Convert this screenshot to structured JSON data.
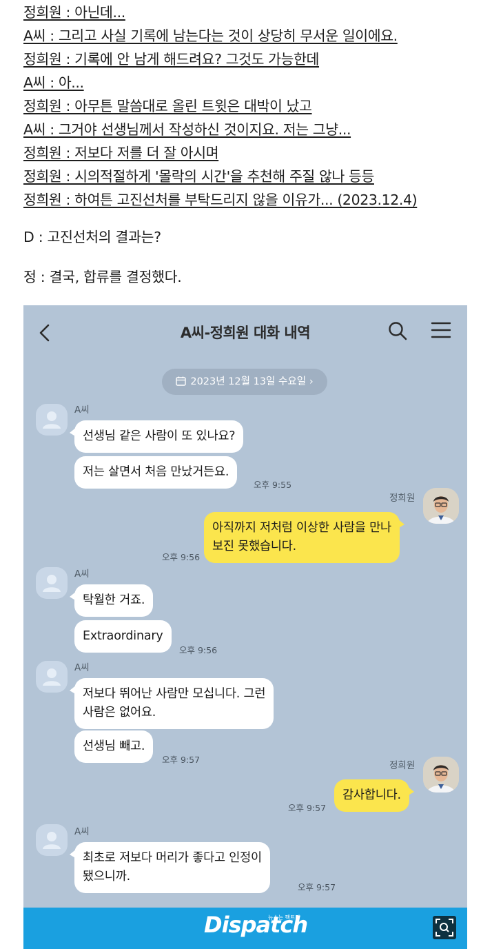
{
  "article": {
    "quotes": [
      "정희원 : 아닌데...",
      "A씨 : 그리고 사실 기록에 남는다는 것이 상당히 무서운 일이에요.",
      "정희원 : 기록에 안 남게 해드려요? 그것도 가능한데",
      "A씨 : 아...",
      "정희원 : 아무튼 말씀대로 올린 트윗은 대박이 났고",
      "A씨 : 그거야 선생님께서 작성하신 것이지요. 저는 그냥...",
      "정희원 : 저보다 저를 더 잘 아시며",
      "정희원 : 시의적절하게 '몰락의 시간'을 추천해 주질 않나 등등",
      "정희원 : 하여튼 고진선처를 부탁드리지 않을 이유가... (2023.12.4)"
    ],
    "question": "D : 고진선처의 결과는?",
    "answer": "정 : 결국, 합류를 결정했다."
  },
  "chat": {
    "title": "A씨-정희원 대화 내역",
    "date": "2023년 12월 13일 수요일",
    "other_name": "A씨",
    "my_name": "정희원",
    "messages": {
      "m1": "선생님 같은 사람이 또 있나요?",
      "m2": "저는 살면서 처음 만났거든요.",
      "t2": "오후 9:55",
      "m3a": "아직까지 저처럼 이상한 사람을 만나",
      "m3b": "보진 못했습니다.",
      "t3": "오후 9:56",
      "m4": "탁월한 거죠.",
      "m5": "Extraordinary",
      "t5": "오후 9:56",
      "m6a": "저보다 뛰어난 사람만 모십니다. 그런",
      "m6b": "사람은 없어요.",
      "m7": "선생님 빼고.",
      "t7": "오후 9:57",
      "m8": "감사합니다.",
      "t8": "오후 9:57",
      "m9a": "최초로 저보다 머리가 좋다고 인정이",
      "m9b": "됐으니까.",
      "t9": "오후 9:57"
    }
  },
  "footer": {
    "logo": "Dispatch",
    "tagline": "뉴스는 팩트다"
  },
  "colors": {
    "chat_bg": "#b3c4d6",
    "my_bubble": "#fbe54d",
    "footer_bar": "#1aa0e0"
  },
  "icons": [
    "back-icon",
    "search-icon",
    "menu-icon",
    "calendar-icon",
    "zoom-icon"
  ]
}
